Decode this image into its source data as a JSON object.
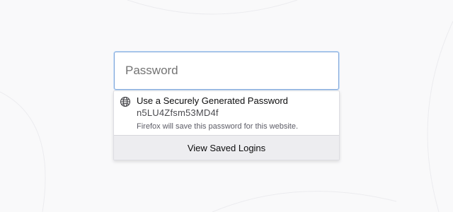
{
  "password_field": {
    "placeholder": "Password",
    "value": ""
  },
  "autocomplete_popup": {
    "suggestion": {
      "icon": "globe-icon",
      "title": "Use a Securely Generated Password",
      "generated_password": "n5LU4Zfsm53MD4f",
      "note": "Firefox will save this password for this website."
    },
    "footer": {
      "label": "View Saved Logins"
    }
  },
  "colors": {
    "page_background": "#f9f9fa",
    "field_border_focus": "#7fa5d9",
    "footer_background": "#ededf0"
  }
}
